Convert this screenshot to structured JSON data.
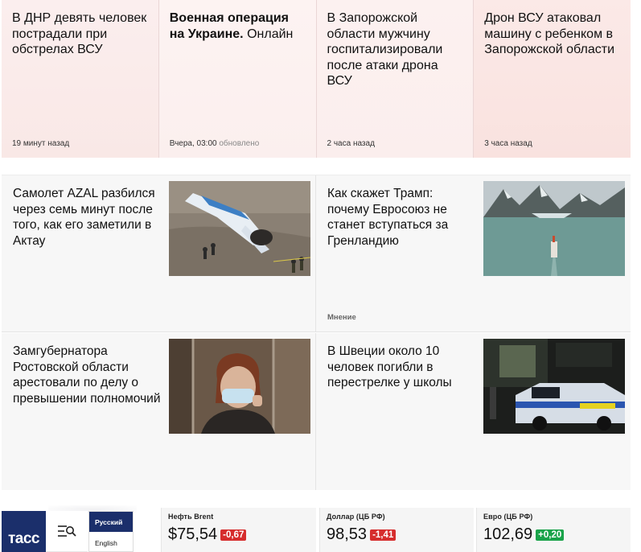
{
  "top_news": [
    {
      "title": "В ДНР девять человек пострадали при обстрелах ВСУ",
      "bold": "",
      "time": "19 минут назад",
      "updated": ""
    },
    {
      "title": "Онлайн",
      "bold": "Военная операция на Украине.",
      "time": "Вчера, 03:00",
      "updated": "обновлено"
    },
    {
      "title": "В Запорожской области мужчину госпитализировали после атаки дрона ВСУ",
      "bold": "",
      "time": "2 часа назад",
      "updated": ""
    },
    {
      "title": "Дрон ВСУ атаковал машину с ребенком в Запорожской области",
      "bold": "",
      "time": "3 часа назад",
      "updated": ""
    }
  ],
  "articles": [
    {
      "title": "Самолет AZAL разбился через семь минут после того, как его заметили в Актау",
      "tag": "",
      "image": "plane-crash-photo"
    },
    {
      "title": "Как скажет Трамп: почему Евросоюз не станет вступаться за Гренландию",
      "tag": "Мнение",
      "image": "greenland-fjord-photo"
    },
    {
      "title": "Замгубернатора Ростовской области арестовали по делу о превышении полномочий",
      "tag": "",
      "image": "courtroom-woman-photo"
    },
    {
      "title": "В Швеции около 10 человек погибли в перестрелке у школы",
      "tag": "",
      "image": "police-car-night-photo"
    }
  ],
  "bottom": {
    "logo": "тасс",
    "menu_icon": "menu-search-icon",
    "lang_ru": "Русский",
    "lang_en": "English",
    "quotes": [
      {
        "label": "Нефть Brent",
        "value": "$75,54",
        "change": "-0,67",
        "direction": "down"
      },
      {
        "label": "Доллар (ЦБ РФ)",
        "value": "98,53",
        "change": "-1,41",
        "direction": "down"
      },
      {
        "label": "Евро (ЦБ РФ)",
        "value": "102,69",
        "change": "+0,20",
        "direction": "up"
      }
    ]
  },
  "colors": {
    "brand": "#1b2f6b",
    "negative": "#d62d2d",
    "positive": "#1aa34a"
  }
}
